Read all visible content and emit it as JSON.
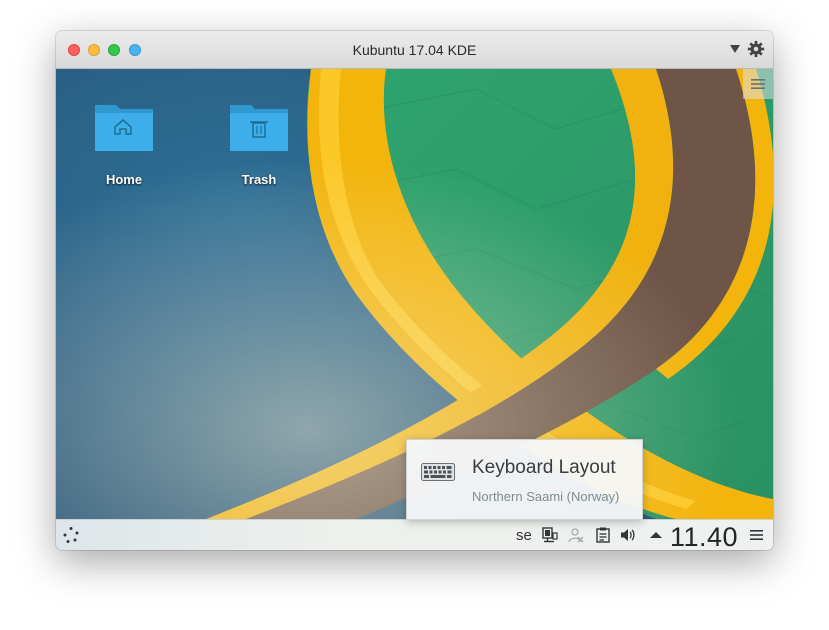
{
  "window": {
    "title": "Kubuntu 17.04 KDE"
  },
  "desktop": {
    "icons": [
      {
        "label": "Home",
        "icon": "home-folder-icon"
      },
      {
        "label": "Trash",
        "icon": "trash-folder-icon"
      }
    ],
    "menu_icon": "hamburger-menu-icon"
  },
  "taskbar": {
    "keyboard_layout_short": "se",
    "clock": "11.40",
    "tray_icons": [
      "network-display-icon",
      "user-icon",
      "clipboard-icon",
      "volume-icon",
      "expand-up-icon",
      "panel-menu-icon"
    ]
  },
  "osd": {
    "title": "Keyboard Layout",
    "subtitle": "Northern Saami (Norway)",
    "icon": "keyboard-icon"
  },
  "colors": {
    "folder_blue": "#3daee9",
    "accent_yellow": "#f5b80f",
    "wallpaper_green": "#2fa06c",
    "wallpaper_blue": "#2a5f85"
  }
}
